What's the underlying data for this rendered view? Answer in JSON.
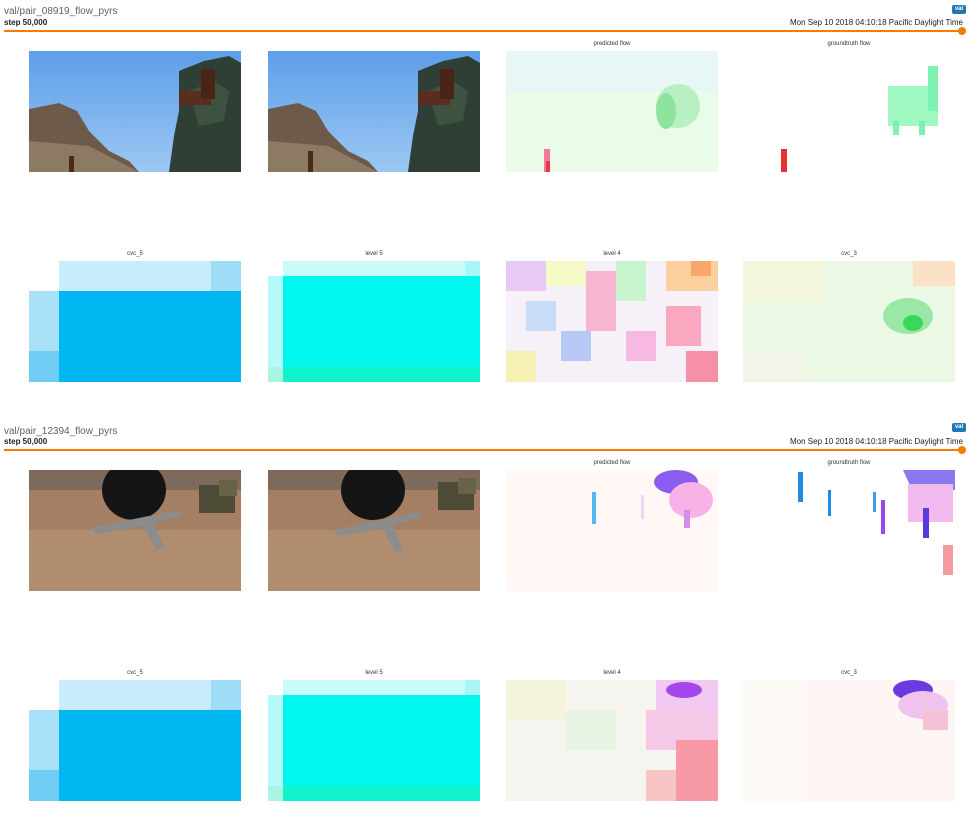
{
  "cards": [
    {
      "title": "val/pair_08919_flow_pyrs",
      "step": "step 50,000",
      "timestamp": "Mon Sep 10 2018 04:10:18 Pacific Daylight Time",
      "run": "val",
      "row1_labels": [
        "",
        "",
        "predicted flow",
        "groundtruth flow"
      ],
      "row2_labels": [
        "cvc_5",
        "level 5",
        "level 4",
        "cvc_3"
      ]
    },
    {
      "title": "val/pair_12394_flow_pyrs",
      "step": "step 50,000",
      "timestamp": "Mon Sep 10 2018 04:10:18 Pacific Daylight Time",
      "run": "val",
      "row1_labels": [
        "",
        "",
        "predicted flow",
        "groundtruth flow"
      ],
      "row2_labels": [
        "cvc_5",
        "level 5",
        "level 4",
        "cvc_3"
      ]
    }
  ],
  "colors": {
    "accent": "#f57c00",
    "badge": "#1f78b4"
  }
}
